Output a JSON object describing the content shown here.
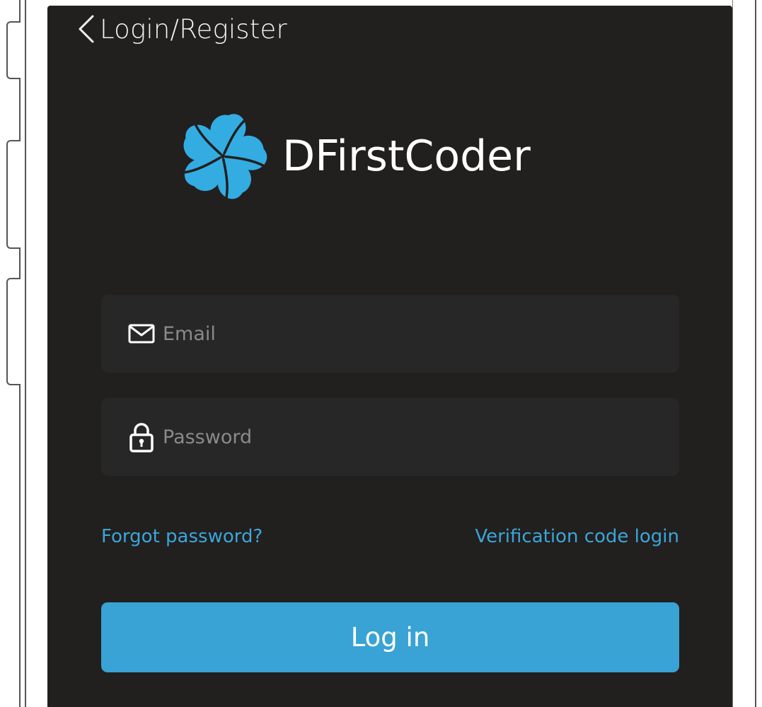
{
  "header": {
    "title": "Login/Register"
  },
  "brand": {
    "name": "DFirstCoder",
    "accent_color": "#38a3d4"
  },
  "form": {
    "email_placeholder": "Email",
    "email_value": "",
    "password_placeholder": "Password",
    "password_value": ""
  },
  "links": {
    "forgot_password": "Forgot password?",
    "verification_code_login": "Verification code login"
  },
  "actions": {
    "login_label": "Log in"
  },
  "icons": {
    "back": "chevron-left-icon",
    "logo": "aperture-logo-icon",
    "email": "envelope-icon",
    "password": "lock-icon"
  }
}
